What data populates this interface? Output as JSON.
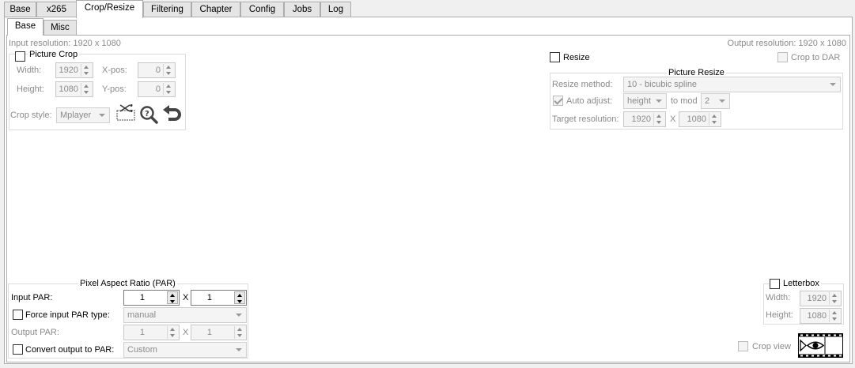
{
  "tabs": [
    "Base",
    "x265",
    "Crop/Resize",
    "Filtering",
    "Chapter",
    "Config",
    "Jobs",
    "Log"
  ],
  "subtabs": [
    "Base",
    "Misc"
  ],
  "input_resolution": "Input resolution: 1920 x 1080",
  "output_resolution": "Output resolution: 1920 x 1080",
  "crop": {
    "title": "Picture Crop",
    "width_label": "Width:",
    "width": "1920",
    "height_label": "Height:",
    "height": "1080",
    "xpos_label": "X-pos:",
    "xpos": "0",
    "ypos_label": "Y-pos:",
    "ypos": "0",
    "style_label": "Crop style:",
    "style": "Mplayer"
  },
  "resize": {
    "checkbox": "Resize",
    "crop_to_dar": "Crop to DAR",
    "group_title": "Picture Resize",
    "method_label": "Resize method:",
    "method": "10 - bicubic spline",
    "auto_adjust": "Auto adjust:",
    "auto_adjust_value": "height",
    "to_mod": "to mod",
    "mod": "2",
    "target_label": "Target resolution:",
    "target_w": "1920",
    "x": "X",
    "target_h": "1080"
  },
  "par": {
    "title": "Pixel Aspect Ratio (PAR)",
    "input_label": "Input PAR:",
    "input_1": "1",
    "x": "X",
    "input_2": "1",
    "force_label": "Force input PAR type:",
    "force_value": "manual",
    "output_label": "Output PAR:",
    "output_1": "1",
    "output_2": "1",
    "convert_label": "Convert output to PAR:",
    "convert_value": "Custom"
  },
  "letterbox": {
    "title": "Letterbox",
    "width_label": "Width:",
    "width": "1920",
    "height_label": "Height:",
    "height": "1080"
  },
  "crop_view": "Crop view"
}
